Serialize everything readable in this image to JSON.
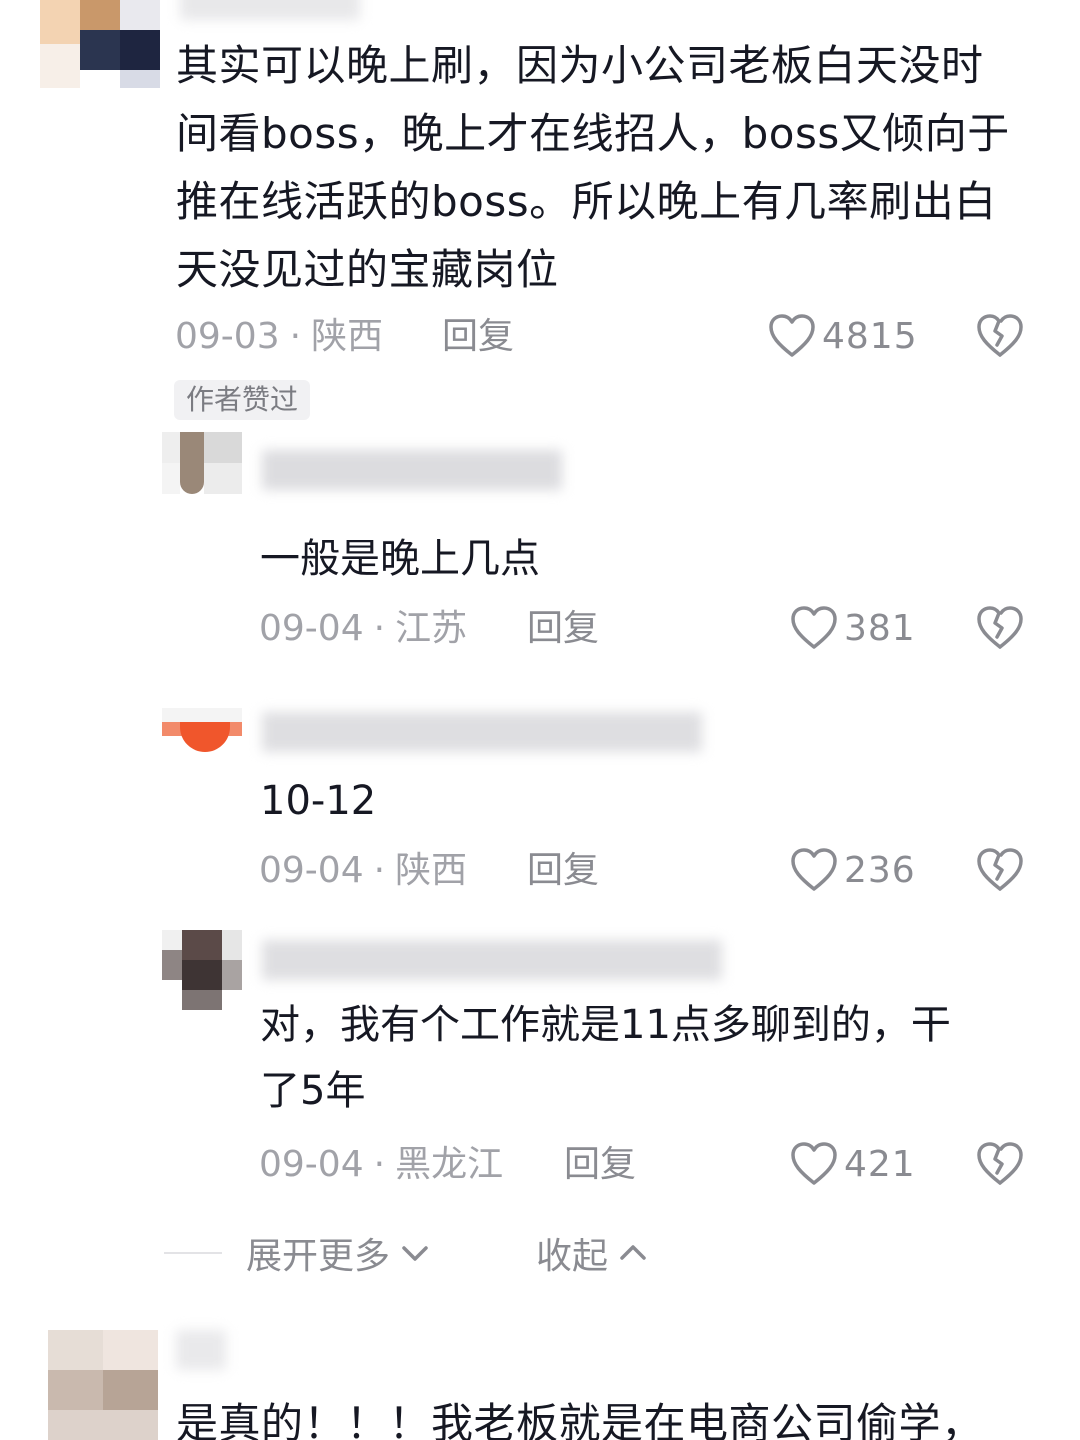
{
  "comments": [
    {
      "text": "其实可以晚上刷，因为小公司老板白天没时\n间看boss，晚上才在线招人，boss又倾向于\n推在线活跃的boss。所以晚上有几率刷出白\n天没见过的宝藏岗位",
      "date": "09-03",
      "location": "陕西",
      "reply_label": "回复",
      "likes": "4815",
      "badge": "作者赞过"
    }
  ],
  "replies": [
    {
      "text": "一般是晚上几点",
      "date": "09-04",
      "location": "江苏",
      "reply_label": "回复",
      "likes": "381"
    },
    {
      "text": "10-12",
      "date": "09-04",
      "location": "陕西",
      "reply_label": "回复",
      "likes": "236"
    },
    {
      "text": "对，我有个工作就是11点多聊到的，干\n了5年",
      "date": "09-04",
      "location": "黑龙江",
      "reply_label": "回复",
      "likes": "421"
    }
  ],
  "thread_controls": {
    "expand_more": "展开更多",
    "collapse": "收起"
  },
  "next_comment": {
    "text": "是真的！！！我老板就是在电商公司偷学，"
  },
  "icons": {
    "like": "heart-outline-icon",
    "dislike": "broken-heart-icon",
    "expand": "chevron-down-icon",
    "collapse": "chevron-up-icon"
  },
  "colors": {
    "text": "#161823",
    "meta": "#a1a2a8",
    "secondary": "#8a8b91",
    "badge_bg": "#f1f1f3"
  }
}
